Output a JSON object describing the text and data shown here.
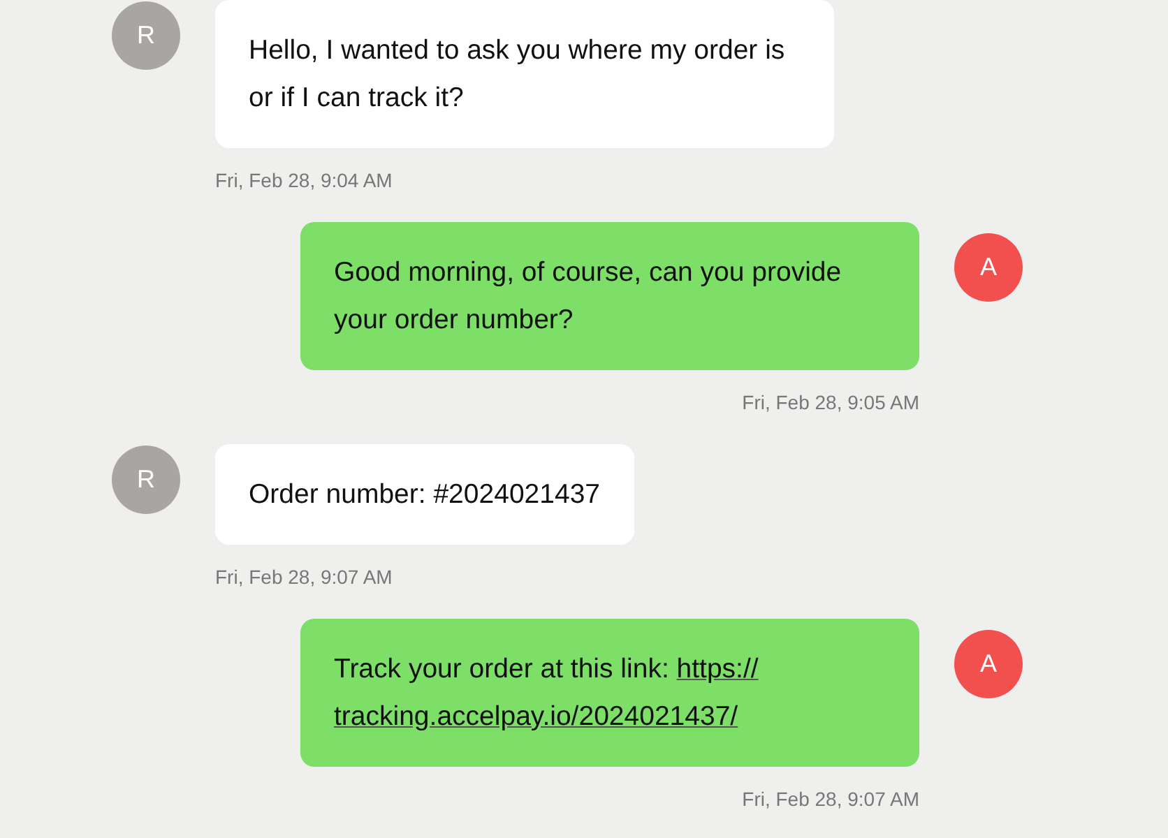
{
  "messages": [
    {
      "kind": "incoming",
      "avatar": "R",
      "lines": [
        "Hello, I wanted to ask you where my order is or if I can track it?"
      ],
      "time": "Fri, Feb 28, 9:04 AM"
    },
    {
      "kind": "outgoing",
      "avatar": "A",
      "lines": [
        "Good morning, of course, can you provide your order number?"
      ],
      "time": "Fri, Feb 28, 9:05 AM"
    },
    {
      "kind": "incoming",
      "avatar": "R",
      "lines": [
        "Order number: #2024021437"
      ],
      "time": "Fri, Feb 28, 9:07 AM"
    },
    {
      "kind": "outgoing",
      "avatar": "A",
      "text": "Track your order at this link:",
      "link_lines": [
        "https://",
        "tracking.accelpay.io/2024021437/"
      ],
      "time": "Fri, Feb 28, 9:07 AM"
    }
  ]
}
